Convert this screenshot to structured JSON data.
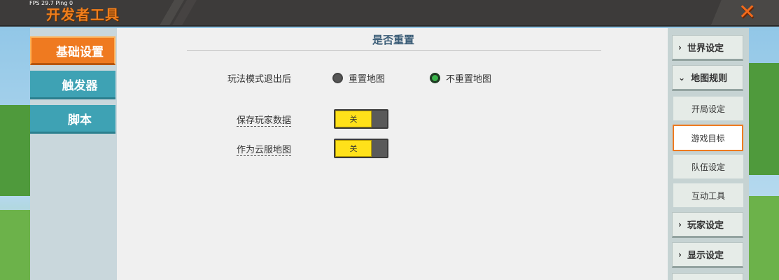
{
  "header": {
    "fps": "FPS 29.7  Ping 0",
    "title": "开发者工具",
    "close_glyph": "✕"
  },
  "left_nav": {
    "items": [
      {
        "label": "基础设置",
        "active": true
      },
      {
        "label": "触发器",
        "active": false
      },
      {
        "label": "脚本",
        "active": false
      }
    ]
  },
  "main": {
    "section_title": "是否重置",
    "rows": [
      {
        "label": "玩法模式退出后",
        "options": [
          {
            "label": "重置地图",
            "selected": false
          },
          {
            "label": "不重置地图",
            "selected": true
          }
        ]
      },
      {
        "label": "保存玩家数据",
        "toggle_label": "关",
        "toggle_on": false
      },
      {
        "label": "作为云服地图",
        "toggle_label": "关",
        "toggle_on": false
      }
    ]
  },
  "right_nav": {
    "groups": [
      {
        "label": "世界设定",
        "chevron": "›",
        "expanded": false
      },
      {
        "label": "地图规则",
        "chevron": "⌄",
        "expanded": true
      },
      {
        "label": "玩家设定",
        "chevron": "›",
        "expanded": false
      },
      {
        "label": "显示设定",
        "chevron": "›",
        "expanded": false
      }
    ],
    "sub_items": [
      {
        "label": "开局设定",
        "active": false
      },
      {
        "label": "游戏目标",
        "active": true
      },
      {
        "label": "队伍设定",
        "active": false
      },
      {
        "label": "互动工具",
        "active": false
      }
    ]
  },
  "colors": {
    "accent_orange": "#ef7a20",
    "tab_teal": "#3ea2b4",
    "toggle_yellow": "#ffe11a",
    "radio_green": "#39b54a"
  }
}
